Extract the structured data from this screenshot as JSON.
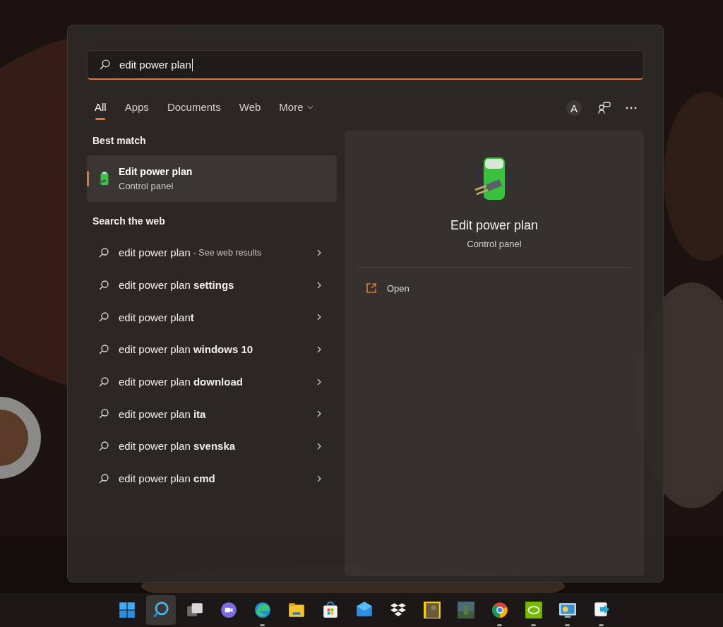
{
  "search": {
    "value": "edit power plan"
  },
  "tabs": [
    {
      "label": "All",
      "selected": true,
      "kind": "plain"
    },
    {
      "label": "Apps",
      "selected": false,
      "kind": "plain"
    },
    {
      "label": "Documents",
      "selected": false,
      "kind": "plain"
    },
    {
      "label": "Web",
      "selected": false,
      "kind": "plain"
    },
    {
      "label": "More",
      "selected": false,
      "kind": "menu"
    }
  ],
  "account": {
    "initial": "A"
  },
  "best_match": {
    "heading": "Best match",
    "item": {
      "title": "Edit power plan",
      "subtitle": "Control panel",
      "selected": true
    }
  },
  "web": {
    "heading": "Search the web",
    "items": [
      {
        "text": "edit power plan",
        "note": "- See web results"
      },
      {
        "text": "edit power plan **settings**"
      },
      {
        "text": "edit power plan**t**"
      },
      {
        "text": "edit power plan **windows 10**"
      },
      {
        "text": "edit power plan **download**"
      },
      {
        "text": "edit power plan **ita**"
      },
      {
        "text": "edit power plan **svenska**"
      },
      {
        "text": "edit power plan **cmd**"
      }
    ]
  },
  "detail": {
    "title": "Edit power plan",
    "subtitle": "Control panel",
    "actions": [
      {
        "label": "Open"
      }
    ]
  },
  "taskbar": [
    {
      "kind": "start",
      "running": false,
      "selected": false
    },
    {
      "kind": "search",
      "running": false,
      "selected": true
    },
    {
      "kind": "taskview",
      "running": false,
      "selected": false
    },
    {
      "kind": "chat",
      "running": false,
      "selected": false
    },
    {
      "kind": "edge",
      "running": true,
      "selected": false
    },
    {
      "kind": "explorer",
      "running": false,
      "selected": false
    },
    {
      "kind": "store",
      "running": false,
      "selected": false
    },
    {
      "kind": "mail",
      "running": false,
      "selected": false
    },
    {
      "kind": "dropbox",
      "running": false,
      "selected": false
    },
    {
      "kind": "game",
      "running": false,
      "selected": false
    },
    {
      "kind": "game2",
      "running": false,
      "selected": false
    },
    {
      "kind": "chrome",
      "running": true,
      "selected": false
    },
    {
      "kind": "nvidia",
      "running": true,
      "selected": false
    },
    {
      "kind": "monitor",
      "running": true,
      "selected": false
    },
    {
      "kind": "remote",
      "running": true,
      "selected": false
    }
  ]
}
